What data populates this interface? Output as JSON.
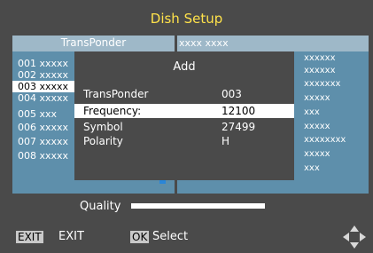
{
  "screen": {
    "title": "Dish Setup"
  },
  "transponder_panel": {
    "header": "TransPonder",
    "items": [
      "001 xxxxx",
      "002 xxxxx",
      "003 xxxxx",
      "004 xxxxx",
      "005 xxx",
      "006 xxxxx",
      "007 xxxxx",
      "008 xxxxx"
    ],
    "selected_index": 2
  },
  "satellite_panel": {
    "header": "xxxx  xxxx",
    "items": [
      "xxxxxx",
      "xxxxxx",
      "xxxxxxx",
      "xxxxx",
      "xxx",
      "xxxxx",
      "xxxxxxxx",
      "xxxxx",
      "xxx"
    ]
  },
  "dialog": {
    "title": "Add",
    "rows": [
      {
        "label": "TransPonder",
        "value": "003"
      },
      {
        "label": "Frequency:",
        "value": "12100"
      },
      {
        "label": "Symbol",
        "value": "27499"
      },
      {
        "label": "Polarity",
        "value": "H"
      }
    ],
    "selected_row": 1
  },
  "quality": {
    "label": "Quality",
    "level": 1.0
  },
  "footer": {
    "exit_key": "EXIT",
    "exit_label": "EXIT",
    "ok_key": "OK",
    "ok_label": "Select",
    "move_icon": "four-way-arrows-icon"
  },
  "colors": {
    "title": "#ffe24a",
    "panel_header": "#9eb8c8",
    "panel_body": "#5e8fab",
    "background": "#4a4a4a",
    "highlight": "#ffffff",
    "cursor_mark": "#2a86d8"
  }
}
